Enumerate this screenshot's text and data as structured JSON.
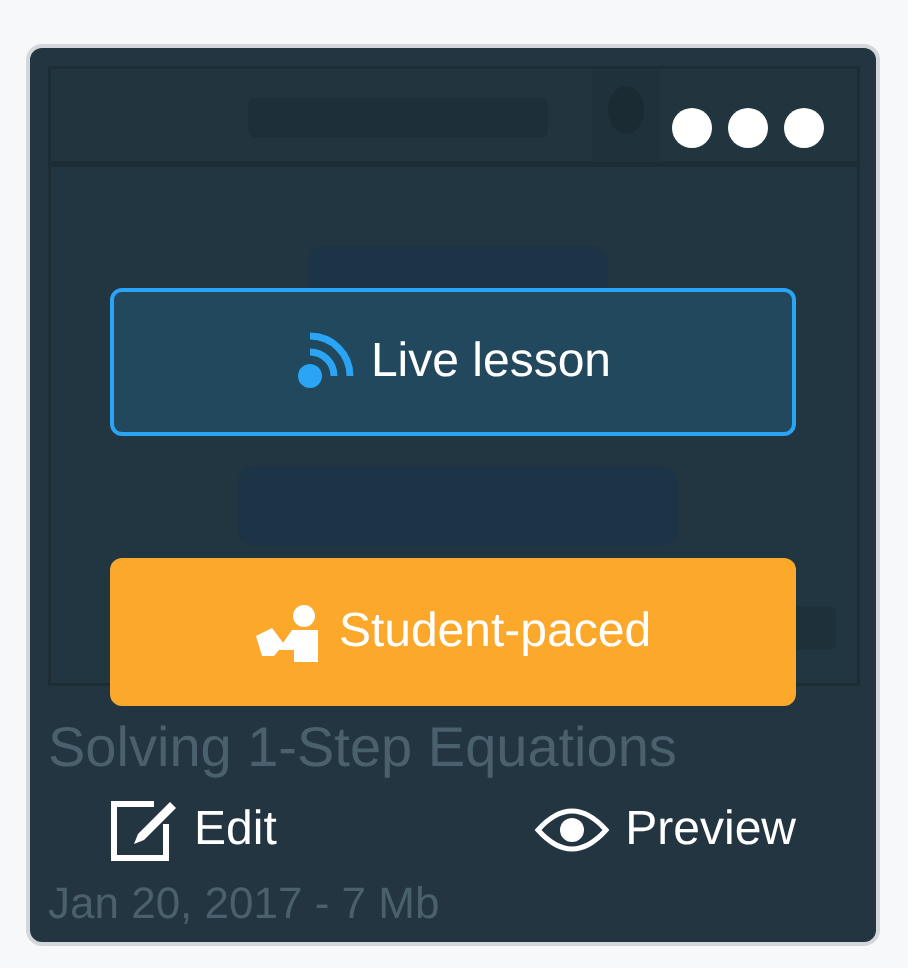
{
  "card": {
    "title": "Solving 1-Step Equations",
    "meta": "Jan 20, 2017 - 7 Mb"
  },
  "actions": [
    {
      "kind": "live",
      "label": "Live lesson"
    },
    {
      "kind": "student",
      "label": "Student-paced"
    }
  ],
  "links": [
    {
      "kind": "edit",
      "label": "Edit"
    },
    {
      "kind": "preview",
      "label": "Preview"
    }
  ]
}
